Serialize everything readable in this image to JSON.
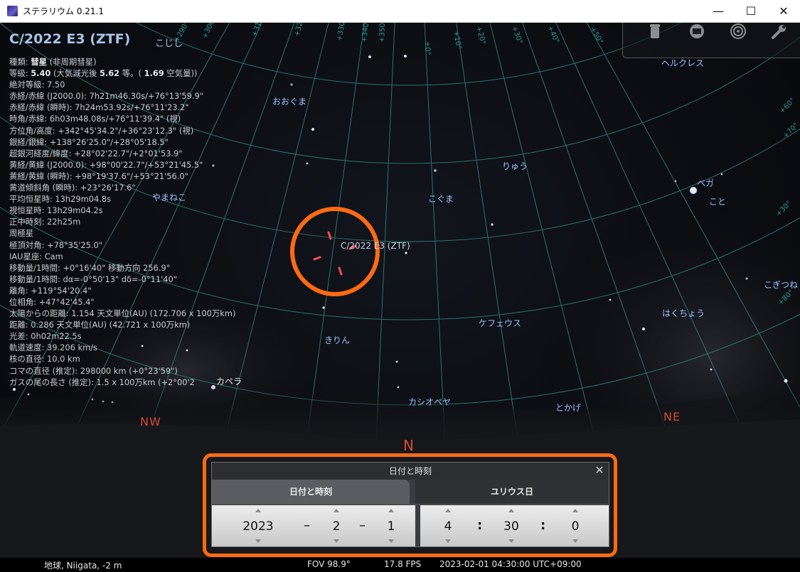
{
  "window": {
    "title": "ステラリウム 0.21.1",
    "minimize": "—",
    "maximize": "☐",
    "close": "✕"
  },
  "object": {
    "name": "C/2022 E3 (ZTF)",
    "alias": "こじし",
    "info": [
      {
        "label": "種類:",
        "bold": "彗星",
        "rest": " (非周期彗星)"
      },
      {
        "label": "等級:",
        "bold": "5.40",
        "rest": " (大気減光後 ",
        "bold2": "5.62",
        "rest2": " 等。( ",
        "bold3": "1.69",
        "rest3": " 空気量))"
      },
      {
        "text": "絶対等級: 7.50"
      },
      {
        "text": "赤経/赤緯 (J2000.0): 7h21m46.30s/+76°13'59.9\""
      },
      {
        "text": "赤経/赤緯 (瞬時): 7h24m53.92s/+76°11'23.2\""
      },
      {
        "text": "時角/赤緯: 6h03m48.08s/+76°11'39.4\" (視)"
      },
      {
        "text": "方位角/高度: +342°45'34.2\"/+36°23'12.3\" (視)"
      },
      {
        "text": "銀経/銀緯: +138°26'25.0\"/+28°05'18.5\""
      },
      {
        "text": "超銀河経度/緯度: +28°02'22.7\"/+2°01'53.9\""
      },
      {
        "text": "黄経/黄緯 (J2000.0): +98°00'22.7\"/+53°21'45.5\""
      },
      {
        "text": "黄経/黄緯 (瞬時): +98°19'37.6\"/+53°21'56.0\""
      },
      {
        "text": "黄道傾斜角 (瞬時): +23°26'17.6\""
      },
      {
        "text": "平均恒星時: 13h29m04.8s"
      },
      {
        "text": "視恒星時: 13h29m04.2s"
      },
      {
        "text": "正中時刻: 22h25m"
      },
      {
        "text": "周極星"
      },
      {
        "text": "極頂対角: +78°35'25.0\""
      },
      {
        "text": "IAU星座: Cam"
      },
      {
        "text": "移動量/1時間: +0°16'40\" 移動方向 256.9°"
      },
      {
        "text": "移動量/1時間: dα=-0°50'13\" dδ=-0°11'40\""
      },
      {
        "text": "離角: +119°54'20.4\""
      },
      {
        "text": "位相角: +47°42'45.4\""
      },
      {
        "text": "太陽からの距離: 1.154 天文単位(AU) (172.706 x 100万km)"
      },
      {
        "text": "距離: 0.286 天文単位(AU) (42.721 x 100万km)"
      },
      {
        "text": "光差: 0h02m22.5s"
      },
      {
        "text": "軌道速度: 39.206 km/s"
      },
      {
        "text": "核の直径: 10.0 km"
      },
      {
        "text": "コマの直径 (推定): 298000 km (+0°23'59\")"
      },
      {
        "text": "ガスの尾の長さ (推定): 1.5 x 100万km (+2°00'2"
      }
    ]
  },
  "sky": {
    "constellations": [
      "ヘルクレス",
      "おおぐま",
      "りゅう",
      "ベガ",
      "こと",
      "やまねこ",
      "こぐま",
      "C/2022 E3 (ZTF)",
      "こぎつね",
      "はくちょう",
      "ケフェウス",
      "きりん",
      "カペラ",
      "カシオペヤ",
      "とかげ"
    ],
    "cardinals": {
      "nw": "NW",
      "n": "N",
      "ne": "NE"
    },
    "grid_labels_top": [
      "+290°",
      "+300°",
      "+310°",
      "+320°",
      "+330°",
      "+340°",
      "+350°",
      "+0°",
      "+10°",
      "+20°",
      "+30°",
      "+40°",
      "+50°",
      "+60°",
      "+70°"
    ],
    "grid_labels_right": [
      "+30°",
      "+80°",
      "+20°",
      "+10°"
    ]
  },
  "toolbar": {
    "icons": [
      "trash-icon",
      "window-icon",
      "target-icon",
      "wrench-icon"
    ]
  },
  "dialog": {
    "title": "日付と時刻",
    "close": "✕",
    "tab_date": "日付と時刻",
    "tab_julian": "ユリウス日",
    "year": "2023",
    "month": "2",
    "day": "1",
    "hour": "4",
    "minute": "30",
    "second": "0",
    "date_sep": "–",
    "time_sep": ":"
  },
  "status": {
    "location": "地球, Niigata, -2 m",
    "fov": "FOV 98.9°",
    "fps": "17.8 FPS",
    "datetime": "2023-02-01 04:30:00 UTC+09:00"
  },
  "colors": {
    "highlight": "#ff6a13",
    "label": "#9cc2ff",
    "cardinal": "#d84a32",
    "grid": "#2f7d78"
  }
}
